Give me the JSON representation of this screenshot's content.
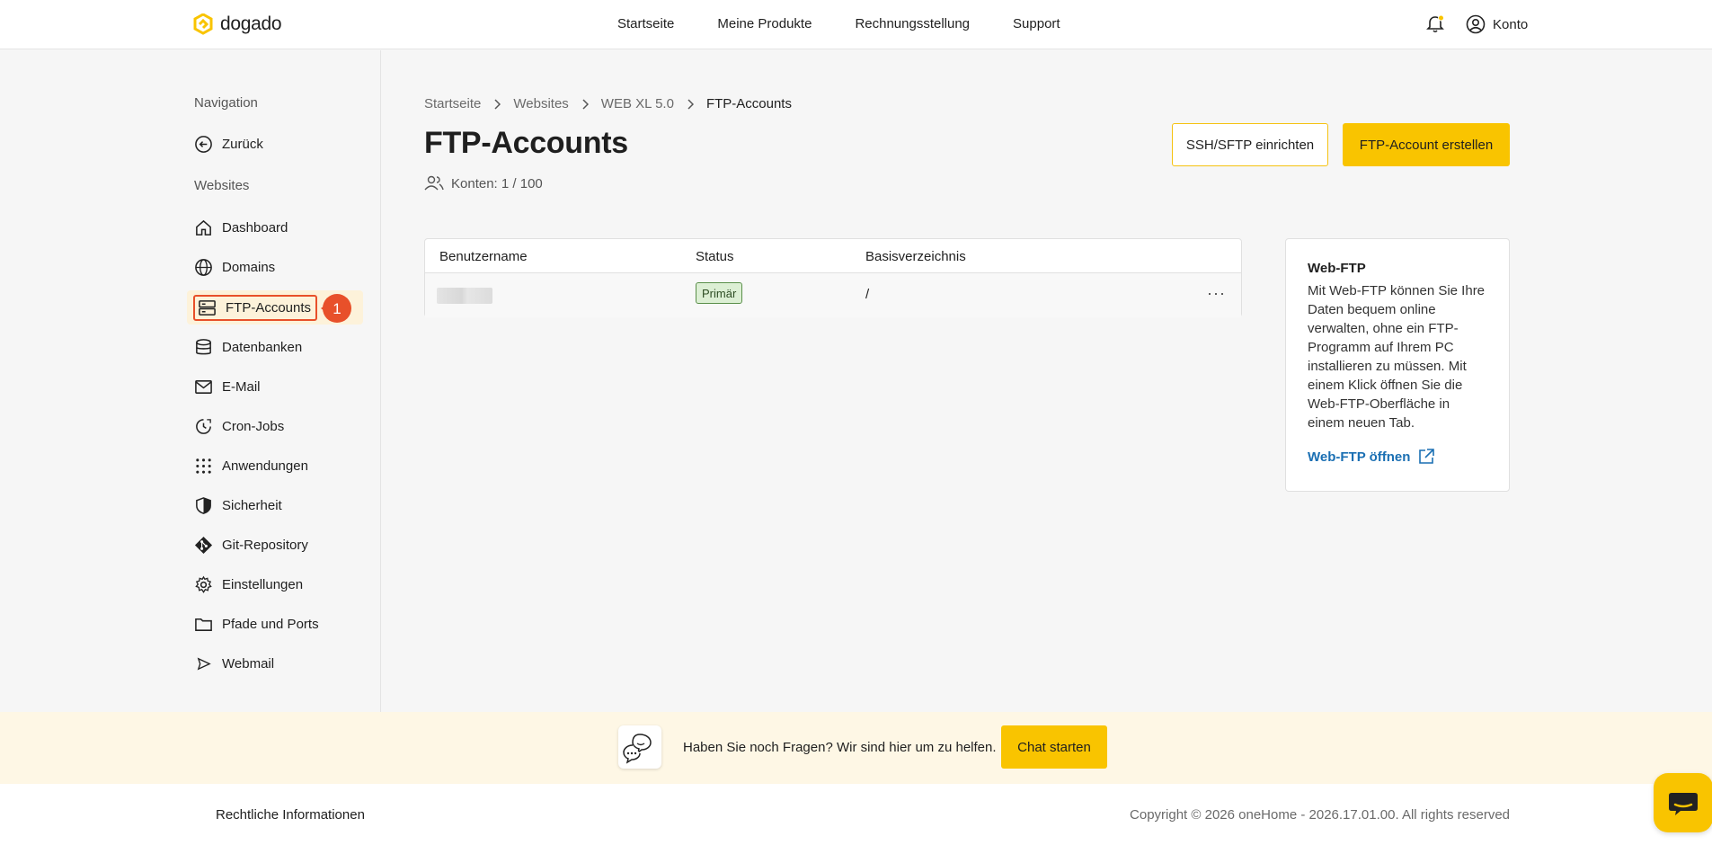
{
  "header": {
    "logo_text": "dogado",
    "nav": [
      "Startseite",
      "Meine Produkte",
      "Rechnungsstellung",
      "Support"
    ],
    "account_label": "Konto"
  },
  "sidebar": {
    "nav_heading": "Navigation",
    "back_label": "Zurück",
    "section_heading": "Websites",
    "items": [
      {
        "label": "Dashboard",
        "icon": "home-icon"
      },
      {
        "label": "Domains",
        "icon": "globe-icon"
      },
      {
        "label": "FTP-Accounts",
        "icon": "server-icon"
      },
      {
        "label": "Datenbanken",
        "icon": "database-icon"
      },
      {
        "label": "E-Mail",
        "icon": "mail-icon"
      },
      {
        "label": "Cron-Jobs",
        "icon": "clock-icon"
      },
      {
        "label": "Anwendungen",
        "icon": "grid-icon"
      },
      {
        "label": "Sicherheit",
        "icon": "shield-icon"
      },
      {
        "label": "Git-Repository",
        "icon": "git-icon"
      },
      {
        "label": "Einstellungen",
        "icon": "gear-icon"
      },
      {
        "label": "Pfade und Ports",
        "icon": "folder-icon"
      },
      {
        "label": "Webmail",
        "icon": "send-icon"
      }
    ],
    "active_index": 2,
    "annotation_number": "1",
    "annotation_color": "#e8502a"
  },
  "breadcrumb": [
    "Startseite",
    "Websites",
    "WEB XL 5.0",
    "FTP-Accounts"
  ],
  "page": {
    "title": "FTP-Accounts",
    "konten_label": "Konten: 1 / 100",
    "btn_ssh": "SSH/SFTP einrichten",
    "btn_create": "FTP-Account erstellen"
  },
  "table": {
    "headers": [
      "Benutzername",
      "Status",
      "Basisverzeichnis"
    ],
    "rows": [
      {
        "username": "",
        "status": "Primär",
        "basedir": "/",
        "more": "···"
      }
    ]
  },
  "webftp": {
    "title": "Web-FTP",
    "text": "Mit Web-FTP können Sie Ihre Daten bequem online verwalten, ohne ein FTP-Programm auf Ihrem PC installieren zu müssen. Mit einem Klick öffnen Sie die Web-FTP-Oberfläche in einem neuen Tab.",
    "link": "Web-FTP öffnen"
  },
  "help": {
    "text": "Haben Sie noch Fragen? Wir sind hier um zu helfen.",
    "button": "Chat starten"
  },
  "footer": {
    "left": "Rechtliche Informationen",
    "right": "Copyright © 2026 oneHome - 2026.17.01.00. All rights reserved"
  },
  "colors": {
    "accent": "#f9c400",
    "link": "#1a6fb3",
    "status_bg": "#dcefd4"
  }
}
